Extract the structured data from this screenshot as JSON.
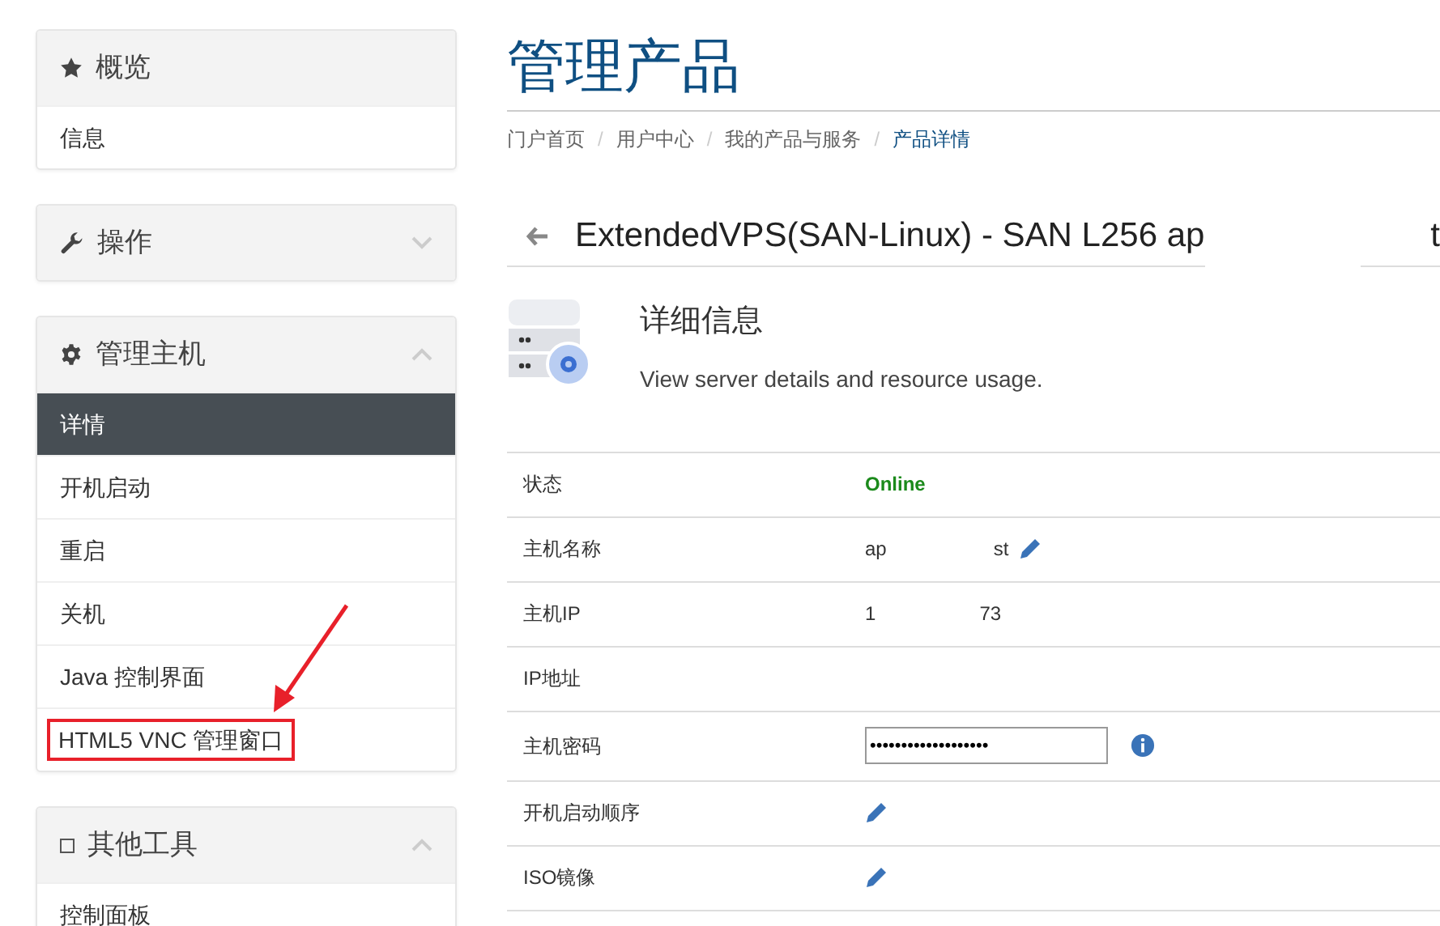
{
  "sidebar": [
    {
      "title": "概览",
      "items": [
        {
          "label": "信息",
          "selected": false,
          "highlighted": false
        }
      ]
    },
    {
      "title": "操作",
      "expanded": false
    },
    {
      "title": "管理主机",
      "expanded": true,
      "items": [
        {
          "label": "详情",
          "selected": true,
          "highlighted": false
        },
        {
          "label": "开机启动",
          "selected": false,
          "highlighted": false
        },
        {
          "label": "重启",
          "selected": false,
          "highlighted": false
        },
        {
          "label": "关机",
          "selected": false,
          "highlighted": false
        },
        {
          "label": "Java 控制界面",
          "selected": false,
          "highlighted": false
        },
        {
          "label": "HTML5 VNC 管理窗口",
          "selected": false,
          "highlighted": true
        }
      ]
    },
    {
      "title": "其他工具",
      "expanded": true,
      "items": [
        {
          "label": "控制面板",
          "selected": false,
          "highlighted": false
        }
      ]
    }
  ],
  "page_title": "管理产品",
  "breadcrumb": [
    {
      "label": "门户首页",
      "selected": false
    },
    {
      "separator": "/",
      "label": "用户中心",
      "selected": false
    },
    {
      "separator": "/",
      "label": "我的产品与服务",
      "selected": false
    },
    {
      "separator": "/",
      "label": "产品详情",
      "selected": true
    }
  ],
  "product_title": {
    "visible_start": "ExtendedVPS(SAN-Linux) - SAN L256 ap",
    "visible_end": "t"
  },
  "details": {
    "heading": "详细信息",
    "description": "View server details and resource usage."
  },
  "rows": [
    {
      "kind": "status",
      "label": "状态",
      "value": "Online"
    },
    {
      "kind": "redacted_edit",
      "label": "主机名称",
      "value_start": "ap",
      "value_end": "st"
    },
    {
      "kind": "redacted",
      "label": "主机IP",
      "value_start": "1",
      "value_end": "73"
    },
    {
      "kind": "empty",
      "label": "IP地址"
    },
    {
      "kind": "password",
      "label": "主机密码",
      "value": "•••••••••••••••••••"
    },
    {
      "kind": "edit",
      "label": "开机启动顺序"
    },
    {
      "kind": "edit",
      "label": "ISO镜像"
    }
  ]
}
